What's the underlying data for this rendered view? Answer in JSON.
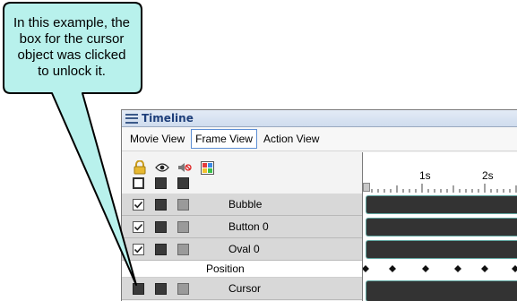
{
  "callout": {
    "lines": [
      "In this example, the",
      "box for the cursor",
      "object was clicked",
      "to unlock it."
    ]
  },
  "timeline": {
    "title": "Timeline",
    "tabs": [
      {
        "label": "Movie View",
        "active": false
      },
      {
        "label": "Frame View",
        "active": true
      },
      {
        "label": "Action View",
        "active": false
      }
    ],
    "column_icons": [
      "lock-icon",
      "eye-icon",
      "speaker-mute-icon",
      "color-grid-icon"
    ],
    "ruler_labels": [
      "1s",
      "2s"
    ],
    "layers": [
      {
        "name": "Bubble",
        "checked": true
      },
      {
        "name": "Button 0",
        "checked": true
      },
      {
        "name": "Oval 0",
        "checked": true
      }
    ],
    "property_row": {
      "name": "Position",
      "keyframe_count": 6
    },
    "cursor_layer": {
      "name": "Cursor",
      "checked": false
    }
  },
  "colors": {
    "callout_fill": "#b8f1ec",
    "callout_border": "#000000",
    "title_text": "#1e3f7a",
    "track_bar": "#333333"
  }
}
